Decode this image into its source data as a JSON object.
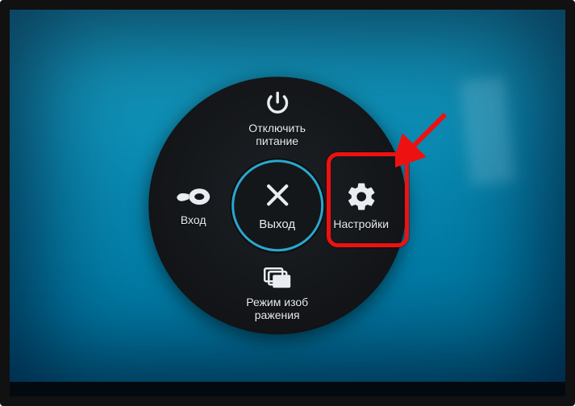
{
  "menu": {
    "top": {
      "label": "Отключить питание",
      "name": "power-off-option"
    },
    "right": {
      "label": "Настройки",
      "name": "settings-option"
    },
    "bottom": {
      "label": "Режим изоб ражения",
      "name": "picture-mode-option"
    },
    "left": {
      "label": "Вход",
      "name": "input-source-option"
    },
    "center": {
      "label": "Выход",
      "name": "exit-option"
    }
  },
  "annotation": {
    "highlight_target": "settings-option",
    "arrow_color": "#e11"
  }
}
